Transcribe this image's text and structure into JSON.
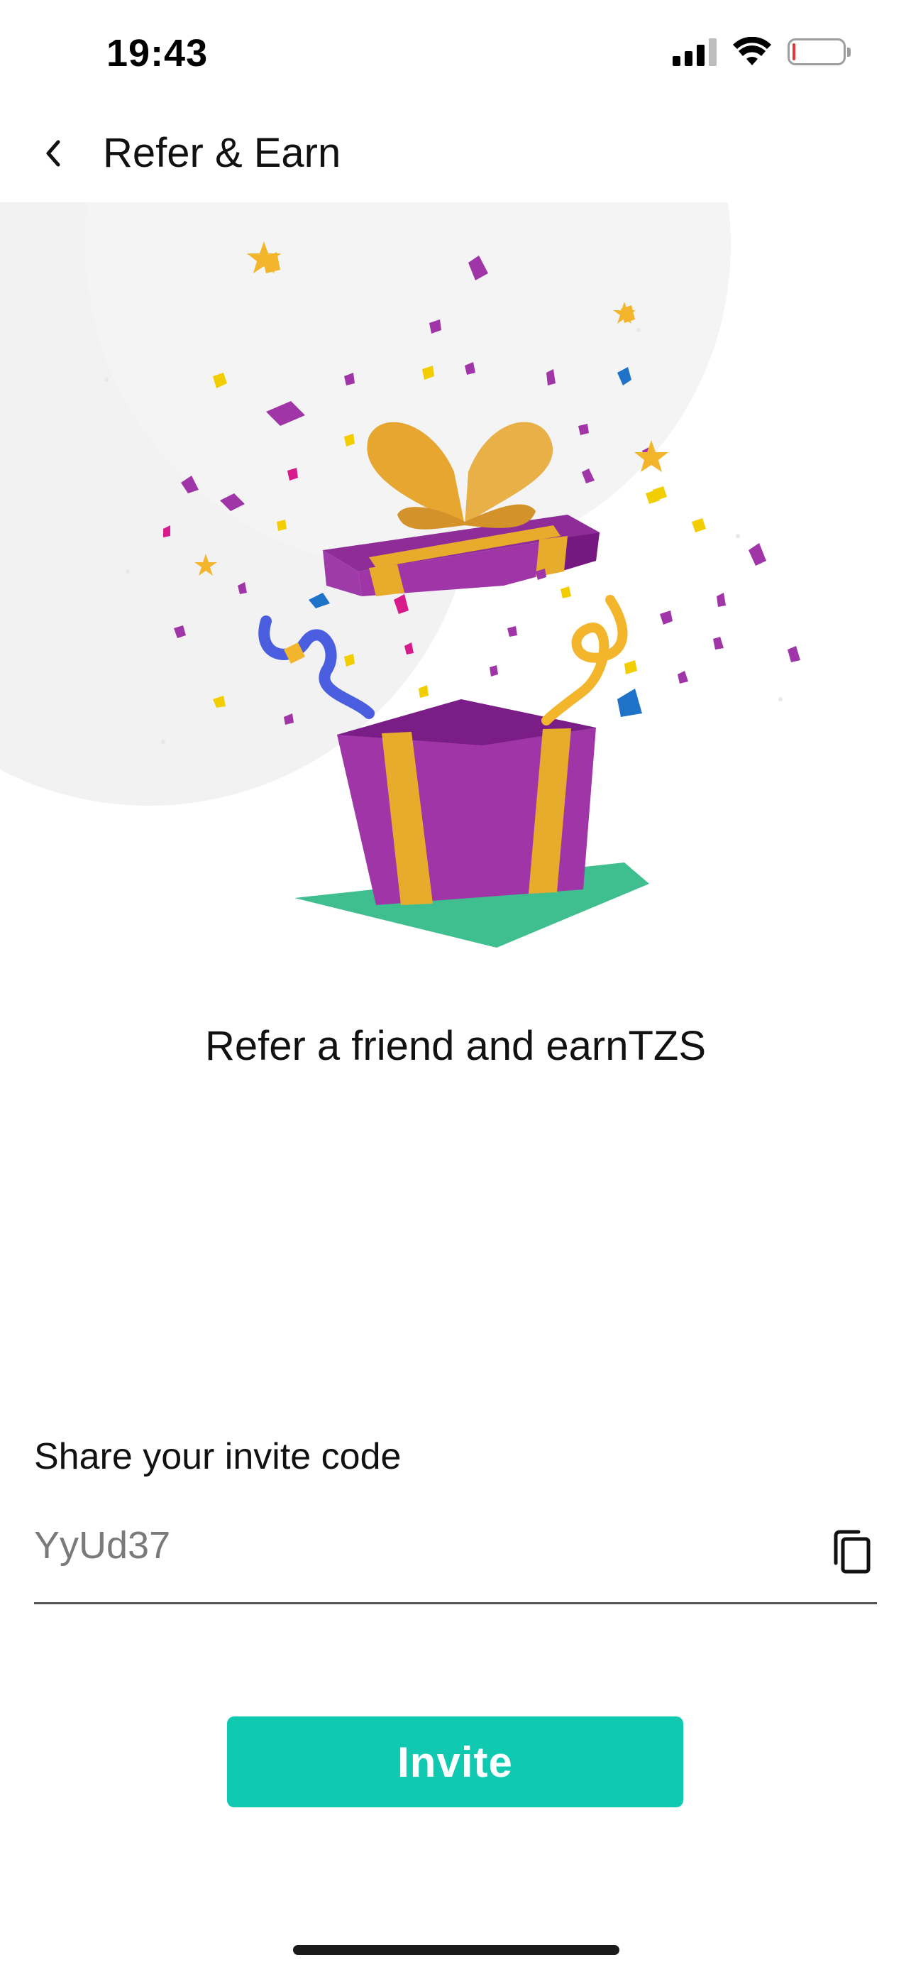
{
  "status_bar": {
    "time": "19:43",
    "icons": [
      "cellular-signal-icon",
      "wifi-icon",
      "battery-icon"
    ]
  },
  "header": {
    "back_icon": "chevron-left-icon",
    "title": "Refer & Earn"
  },
  "hero": {
    "illustration": "open-gift-box-with-confetti"
  },
  "subtitle": "Refer a friend and earnTZS",
  "invite": {
    "label": "Share your invite code",
    "code": "YyUd37",
    "copy_icon": "copy-icon",
    "button_label": "Invite"
  },
  "colors": {
    "accent": "#0fcab1",
    "gift_purple": "#a035a8",
    "gift_ribbon": "#e8ac2c",
    "gift_base": "#3fbf8f"
  }
}
